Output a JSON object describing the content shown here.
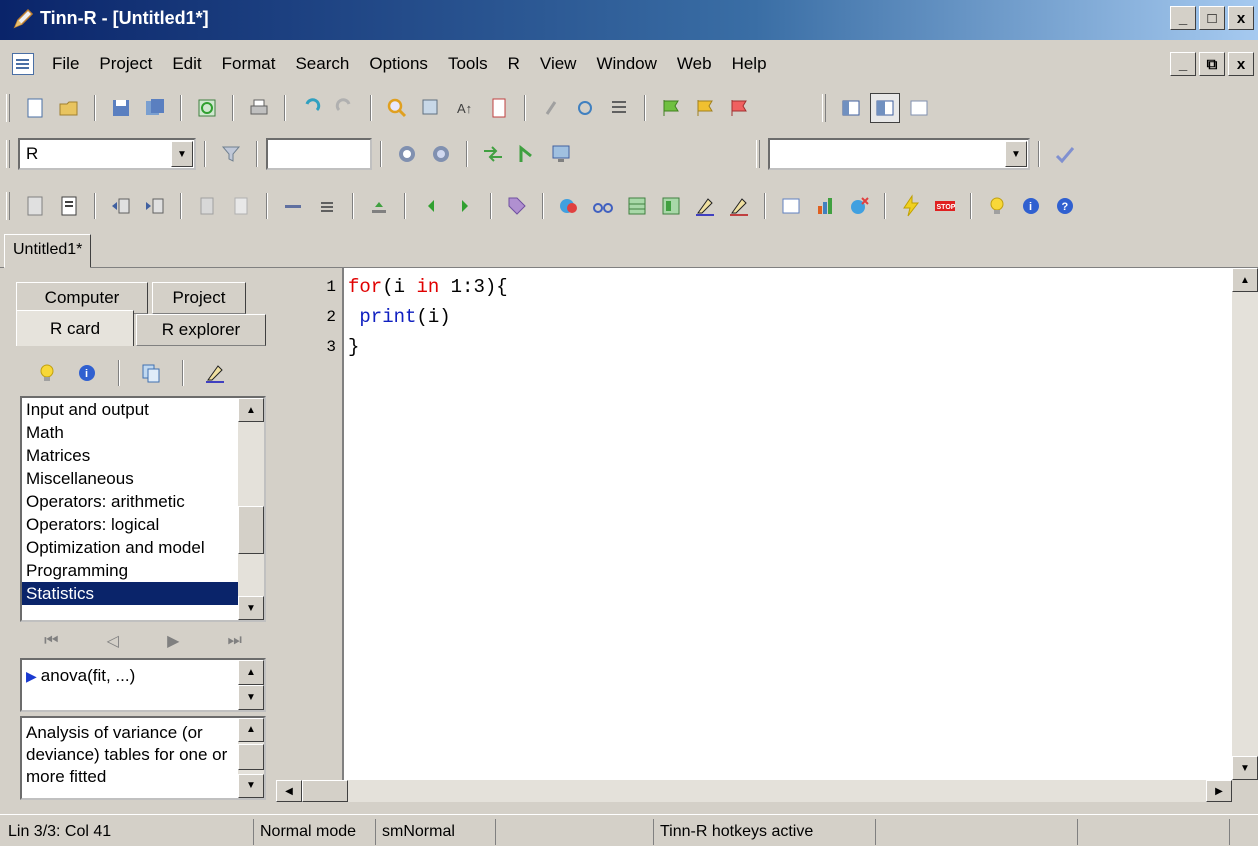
{
  "window": {
    "title": "Tinn-R - [Untitled1*]",
    "minimize": "_",
    "maximize": "□",
    "close": "x"
  },
  "menu": {
    "items": [
      "File",
      "Project",
      "Edit",
      "Format",
      "Search",
      "Options",
      "Tools",
      "R",
      "View",
      "Window",
      "Web",
      "Help"
    ],
    "mdi_minimize": "_",
    "mdi_restore": "⧉",
    "mdi_close": "x"
  },
  "toolbar2": {
    "syntax_combo": "R",
    "combo_arrow": "▼"
  },
  "doc_tabs": [
    "Untitled1*"
  ],
  "left_panel": {
    "tabs_top": [
      "Computer",
      "Project"
    ],
    "tabs_bottom": [
      "R card",
      "R explorer"
    ],
    "categories": [
      "Input and output",
      "Math",
      "Matrices",
      "Miscellaneous",
      "Operators: arithmetic",
      "Operators: logical",
      "Optimization and model",
      "Programming",
      "Statistics"
    ],
    "selected_category": "Statistics",
    "function": "anova(fit, ...)",
    "description": "Analysis of variance (or deviance) tables for one or more fitted"
  },
  "editor": {
    "line_numbers": [
      "1",
      "2",
      "3"
    ],
    "code": {
      "l1_kw": "for",
      "l1_a": "(i ",
      "l1_kw2": "in",
      "l1_b": " 1:3){",
      "l2_indent": " ",
      "l2_fn": "print",
      "l2_rest": "(i)",
      "l3": "}"
    }
  },
  "status": {
    "position": "Lin 3/3: Col 41",
    "mode": "Normal mode",
    "highlighter": "smNormal",
    "hotkeys": "Tinn-R hotkeys active"
  },
  "colors": {
    "title_gradient_start": "#0a246a",
    "selection": "#0a246a",
    "keyword": "#e00000",
    "function": "#1020c0"
  }
}
